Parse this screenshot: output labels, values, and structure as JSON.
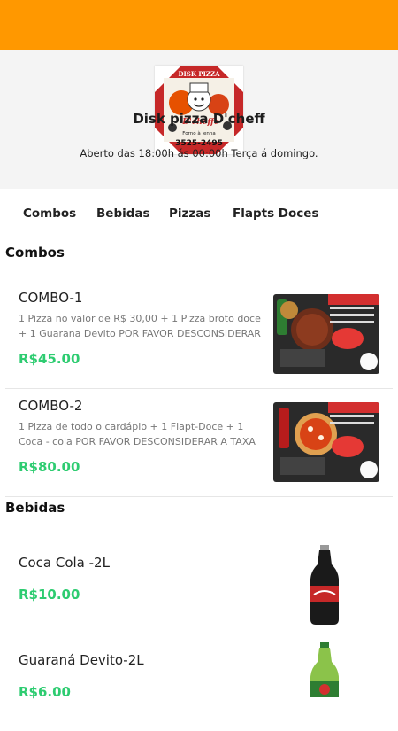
{
  "header": {
    "logo_text": [
      "DISK PIZZA",
      "D'cheffe",
      "Forno à lenha",
      "3525-2495"
    ],
    "store_name": "Disk pizza D'cheff",
    "hours": "Aberto das 18:00h ás 00:00h Terça á domingo."
  },
  "tabs": [
    {
      "label": "Combos"
    },
    {
      "label": "Bebidas"
    },
    {
      "label": "Pizzas"
    },
    {
      "label": "Flapts Doces"
    }
  ],
  "sections": {
    "combos": {
      "title": "Combos",
      "items": [
        {
          "name": "COMBO-1",
          "description": "1 Pizza no valor de R$ 30,00 + 1 Pizza broto doce + 1 Guarana Devito POR FAVOR DESCONSIDERAR A TAXA DE ENTREGA",
          "price": "R$45.00"
        },
        {
          "name": "COMBO-2",
          "description": "1 Pizza de todo o cardápio + 1 Flapt-Doce + 1 Coca - cola POR FAVOR DESCONSIDERAR A TAXA DE ENTREGA",
          "price": "R$80.00"
        }
      ]
    },
    "bebidas": {
      "title": "Bebidas",
      "items": [
        {
          "name": "Coca Cola -2L",
          "price": "R$10.00"
        },
        {
          "name": "Guaraná Devito-2L",
          "price": "R$6.00"
        }
      ]
    }
  },
  "colors": {
    "accent": "#ff9800",
    "price": "#2ecc71",
    "hero_bg": "#f4f4f4"
  }
}
